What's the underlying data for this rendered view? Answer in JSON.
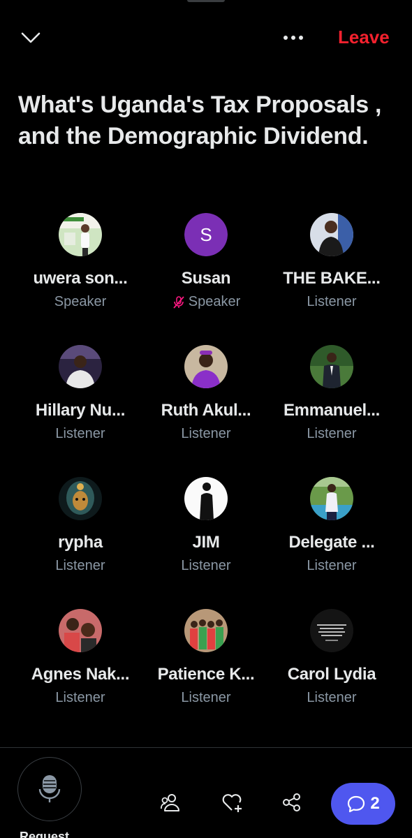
{
  "header": {
    "leave_label": "Leave"
  },
  "space": {
    "title": "What's Uganda's Tax Proposals , and the Demographic Dividend."
  },
  "participants": [
    {
      "name": "uwera son...",
      "role": "Speaker"
    },
    {
      "name": "Susan",
      "role": "Speaker",
      "avatar_letter": "S"
    },
    {
      "name": "THE BAKE...",
      "role": "Listener"
    },
    {
      "name": "Hillary Nu...",
      "role": "Listener"
    },
    {
      "name": "Ruth Akul...",
      "role": "Listener"
    },
    {
      "name": "Emmanuel...",
      "role": "Listener"
    },
    {
      "name": "rypha",
      "role": "Listener"
    },
    {
      "name": "JIM",
      "role": "Listener"
    },
    {
      "name": "Delegate ...",
      "role": "Listener"
    },
    {
      "name": "Agnes Nak...",
      "role": "Listener"
    },
    {
      "name": "Patience K...",
      "role": "Listener"
    },
    {
      "name": "Carol Lydia",
      "role": "Listener"
    }
  ],
  "bottom_bar": {
    "request_label": "Request",
    "chat_count": "2"
  },
  "colors": {
    "leave": "#f4212e",
    "chat_button": "#4f57ef",
    "susan_avatar": "#7b2fb5",
    "muted_mic": "#f91880"
  },
  "icons": {
    "collapse": "chevron-down-icon",
    "more": "more-icon",
    "mic": "microphone-icon",
    "muted": "mic-off-icon",
    "people": "people-icon",
    "react": "heart-plus-icon",
    "share": "share-icon",
    "chat": "chat-bubble-icon"
  }
}
